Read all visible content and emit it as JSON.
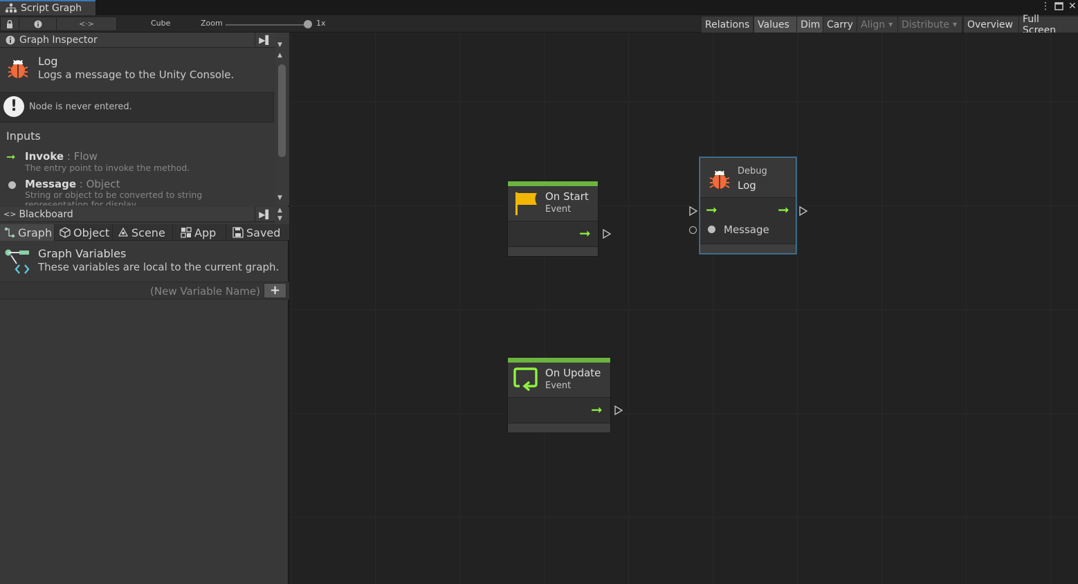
{
  "window": {
    "tab_title": "Script Graph"
  },
  "toolbar": {
    "target": "Cube",
    "zoom_label": "Zoom",
    "zoom_value": "1x",
    "zoom_level": 1.0,
    "buttons": [
      {
        "label": "Relations",
        "state": "normal"
      },
      {
        "label": "Values",
        "state": "on"
      },
      {
        "label": "Dim",
        "state": "on"
      },
      {
        "label": "Carry",
        "state": "normal"
      },
      {
        "label": "Align",
        "state": "disabled"
      },
      {
        "label": "Distribute",
        "state": "disabled"
      },
      {
        "label": "Overview",
        "state": "normal"
      },
      {
        "label": "Full Screen",
        "state": "normal"
      }
    ]
  },
  "inspector": {
    "title": "Graph Inspector",
    "node_title": "Log",
    "node_desc": "Logs a message to the Unity Console.",
    "warning": "Node is never entered.",
    "inputs_heading": "Inputs",
    "ports": [
      {
        "name": "Invoke",
        "type": "Flow",
        "desc": "The entry point to invoke the method."
      },
      {
        "name": "Message",
        "type": "Object",
        "desc": "String or object to be converted to string representation for display."
      }
    ]
  },
  "blackboard": {
    "title": "Blackboard",
    "tabs": [
      "Graph",
      "Object",
      "Scene",
      "App",
      "Saved"
    ],
    "section_title": "Graph Variables",
    "section_desc": "These variables are local to the current graph.",
    "new_var_placeholder": "(New Variable Name)",
    "add_label": "+"
  },
  "graph": {
    "nodes": {
      "on_start": {
        "title": "On Start",
        "subtitle": "Event"
      },
      "on_update": {
        "title": "On Update",
        "subtitle": "Event"
      },
      "debug_log": {
        "category": "Debug",
        "title": "Log",
        "input_label": "Message"
      }
    }
  },
  "colors": {
    "accent_green": "#6cb340",
    "flow_arrow": "#8ef23d",
    "selection_blue": "#4a7ea0",
    "bug_orange": "#f26b3a",
    "flag_yellow": "#f2b705"
  }
}
